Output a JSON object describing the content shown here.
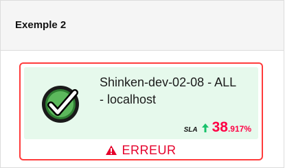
{
  "panel": {
    "title": "Exemple 2"
  },
  "host": {
    "name": "Shinken-dev-02-08 - ALL - localhost",
    "status_icon": "check-circle-icon",
    "status_color": "#2e7d32"
  },
  "sla": {
    "label": "SLA",
    "trend": "up",
    "trend_icon": "arrow-up-icon",
    "trend_color": "#19c26b",
    "value_int": "38",
    "value_dec": ".917%",
    "value_color": "#ff0044"
  },
  "state": {
    "label": "ERREUR",
    "icon": "warning-icon",
    "color": "#e5002b",
    "border_color": "#ff3b3b",
    "background": "#e6f9ec"
  }
}
